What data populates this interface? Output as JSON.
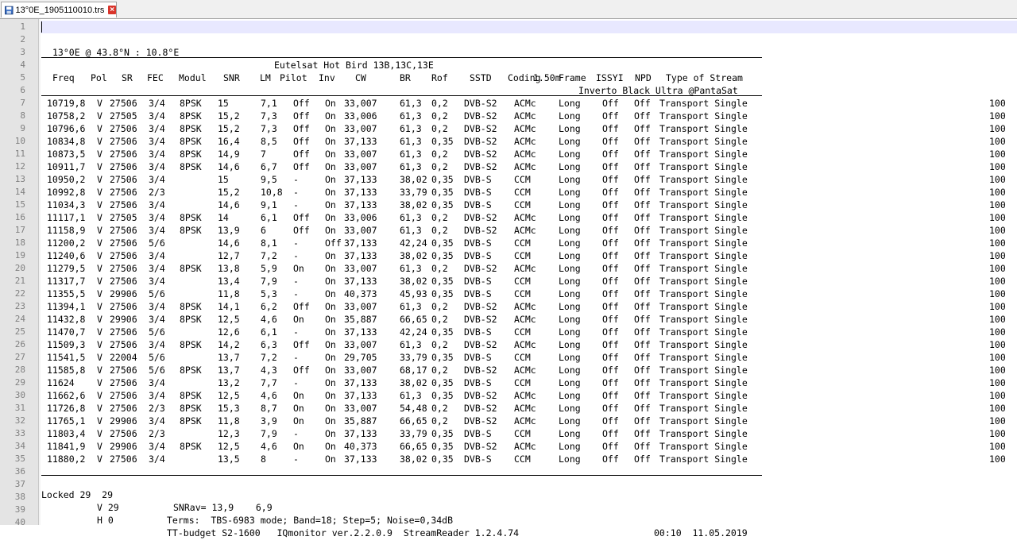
{
  "tab": {
    "label": "13°0E_1905110010.trs",
    "icon": "file-save-icon",
    "close_icon": "close-icon",
    "accent": "#d9342b"
  },
  "header": {
    "position": "13°0E @ 43.8°N : 10.8°E",
    "satellite": "Eutelsat Hot Bird 13B,13C,13E",
    "dish": "1.50m",
    "lnb": "Inverto Black Ultra @PantaSat"
  },
  "columns": [
    "Freq",
    "Pol",
    "SR",
    "FEC",
    "Modul",
    "SNR",
    "LM",
    "Pilot",
    "Inv",
    "CW",
    "BR",
    "Rof",
    "SSTD",
    "Coding",
    "Frame",
    "ISSYI",
    "NPD",
    "Type of Stream"
  ],
  "rows": [
    [
      "10719,8",
      "V",
      "27506",
      "3/4",
      "8PSK",
      "15",
      "7,1",
      "Off",
      "On",
      "33,007",
      "61,3",
      "0,2",
      "DVB-S2",
      "ACMc",
      "Long",
      "Off",
      "Off",
      "Transport Single",
      "100"
    ],
    [
      "10758,2",
      "V",
      "27505",
      "3/4",
      "8PSK",
      "15,2",
      "7,3",
      "Off",
      "On",
      "33,006",
      "61,3",
      "0,2",
      "DVB-S2",
      "ACMc",
      "Long",
      "Off",
      "Off",
      "Transport Single",
      "100"
    ],
    [
      "10796,6",
      "V",
      "27506",
      "3/4",
      "8PSK",
      "15,2",
      "7,3",
      "Off",
      "On",
      "33,007",
      "61,3",
      "0,2",
      "DVB-S2",
      "ACMc",
      "Long",
      "Off",
      "Off",
      "Transport Single",
      "100"
    ],
    [
      "10834,8",
      "V",
      "27506",
      "3/4",
      "8PSK",
      "16,4",
      "8,5",
      "Off",
      "On",
      "37,133",
      "61,3",
      "0,35",
      "DVB-S2",
      "ACMc",
      "Long",
      "Off",
      "Off",
      "Transport Single",
      "100"
    ],
    [
      "10873,5",
      "V",
      "27506",
      "3/4",
      "8PSK",
      "14,9",
      "7",
      "Off",
      "On",
      "33,007",
      "61,3",
      "0,2",
      "DVB-S2",
      "ACMc",
      "Long",
      "Off",
      "Off",
      "Transport Single",
      "100"
    ],
    [
      "10911,7",
      "V",
      "27506",
      "3/4",
      "8PSK",
      "14,6",
      "6,7",
      "Off",
      "On",
      "33,007",
      "61,3",
      "0,2",
      "DVB-S2",
      "ACMc",
      "Long",
      "Off",
      "Off",
      "Transport Single",
      "100"
    ],
    [
      "10950,2",
      "V",
      "27506",
      "3/4",
      "",
      "15",
      "9,5",
      "-",
      "On",
      "37,133",
      "38,02",
      "0,35",
      "DVB-S",
      "CCM",
      "Long",
      "Off",
      "Off",
      "Transport Single",
      "100"
    ],
    [
      "10992,8",
      "V",
      "27506",
      "2/3",
      "",
      "15,2",
      "10,8",
      "-",
      "On",
      "37,133",
      "33,79",
      "0,35",
      "DVB-S",
      "CCM",
      "Long",
      "Off",
      "Off",
      "Transport Single",
      "100"
    ],
    [
      "11034,3",
      "V",
      "27506",
      "3/4",
      "",
      "14,6",
      "9,1",
      "-",
      "On",
      "37,133",
      "38,02",
      "0,35",
      "DVB-S",
      "CCM",
      "Long",
      "Off",
      "Off",
      "Transport Single",
      "100"
    ],
    [
      "11117,1",
      "V",
      "27505",
      "3/4",
      "8PSK",
      "14",
      "6,1",
      "Off",
      "On",
      "33,006",
      "61,3",
      "0,2",
      "DVB-S2",
      "ACMc",
      "Long",
      "Off",
      "Off",
      "Transport Single",
      "100"
    ],
    [
      "11158,9",
      "V",
      "27506",
      "3/4",
      "8PSK",
      "13,9",
      "6",
      "Off",
      "On",
      "33,007",
      "61,3",
      "0,2",
      "DVB-S2",
      "ACMc",
      "Long",
      "Off",
      "Off",
      "Transport Single",
      "100"
    ],
    [
      "11200,2",
      "V",
      "27506",
      "5/6",
      "",
      "14,6",
      "8,1",
      "-",
      "Off",
      "37,133",
      "42,24",
      "0,35",
      "DVB-S",
      "CCM",
      "Long",
      "Off",
      "Off",
      "Transport Single",
      "100"
    ],
    [
      "11240,6",
      "V",
      "27506",
      "3/4",
      "",
      "12,7",
      "7,2",
      "-",
      "On",
      "37,133",
      "38,02",
      "0,35",
      "DVB-S",
      "CCM",
      "Long",
      "Off",
      "Off",
      "Transport Single",
      "100"
    ],
    [
      "11279,5",
      "V",
      "27506",
      "3/4",
      "8PSK",
      "13,8",
      "5,9",
      "On",
      "On",
      "33,007",
      "61,3",
      "0,2",
      "DVB-S2",
      "ACMc",
      "Long",
      "Off",
      "Off",
      "Transport Single",
      "100"
    ],
    [
      "11317,7",
      "V",
      "27506",
      "3/4",
      "",
      "13,4",
      "7,9",
      "-",
      "On",
      "37,133",
      "38,02",
      "0,35",
      "DVB-S",
      "CCM",
      "Long",
      "Off",
      "Off",
      "Transport Single",
      "100"
    ],
    [
      "11355,5",
      "V",
      "29906",
      "5/6",
      "",
      "11,8",
      "5,3",
      "-",
      "On",
      "40,373",
      "45,93",
      "0,35",
      "DVB-S",
      "CCM",
      "Long",
      "Off",
      "Off",
      "Transport Single",
      "100"
    ],
    [
      "11394,1",
      "V",
      "27506",
      "3/4",
      "8PSK",
      "14,1",
      "6,2",
      "Off",
      "On",
      "33,007",
      "61,3",
      "0,2",
      "DVB-S2",
      "ACMc",
      "Long",
      "Off",
      "Off",
      "Transport Single",
      "100"
    ],
    [
      "11432,8",
      "V",
      "29906",
      "3/4",
      "8PSK",
      "12,5",
      "4,6",
      "On",
      "On",
      "35,887",
      "66,65",
      "0,2",
      "DVB-S2",
      "ACMc",
      "Long",
      "Off",
      "Off",
      "Transport Single",
      "100"
    ],
    [
      "11470,7",
      "V",
      "27506",
      "5/6",
      "",
      "12,6",
      "6,1",
      "-",
      "On",
      "37,133",
      "42,24",
      "0,35",
      "DVB-S",
      "CCM",
      "Long",
      "Off",
      "Off",
      "Transport Single",
      "100"
    ],
    [
      "11509,3",
      "V",
      "27506",
      "3/4",
      "8PSK",
      "14,2",
      "6,3",
      "Off",
      "On",
      "33,007",
      "61,3",
      "0,2",
      "DVB-S2",
      "ACMc",
      "Long",
      "Off",
      "Off",
      "Transport Single",
      "100"
    ],
    [
      "11541,5",
      "V",
      "22004",
      "5/6",
      "",
      "13,7",
      "7,2",
      "-",
      "On",
      "29,705",
      "33,79",
      "0,35",
      "DVB-S",
      "CCM",
      "Long",
      "Off",
      "Off",
      "Transport Single",
      "100"
    ],
    [
      "11585,8",
      "V",
      "27506",
      "5/6",
      "8PSK",
      "13,7",
      "4,3",
      "Off",
      "On",
      "33,007",
      "68,17",
      "0,2",
      "DVB-S2",
      "ACMc",
      "Long",
      "Off",
      "Off",
      "Transport Single",
      "100"
    ],
    [
      "11624",
      "V",
      "27506",
      "3/4",
      "",
      "13,2",
      "7,7",
      "-",
      "On",
      "37,133",
      "38,02",
      "0,35",
      "DVB-S",
      "CCM",
      "Long",
      "Off",
      "Off",
      "Transport Single",
      "100"
    ],
    [
      "11662,6",
      "V",
      "27506",
      "3/4",
      "8PSK",
      "12,5",
      "4,6",
      "On",
      "On",
      "37,133",
      "61,3",
      "0,35",
      "DVB-S2",
      "ACMc",
      "Long",
      "Off",
      "Off",
      "Transport Single",
      "100"
    ],
    [
      "11726,8",
      "V",
      "27506",
      "2/3",
      "8PSK",
      "15,3",
      "8,7",
      "On",
      "On",
      "33,007",
      "54,48",
      "0,2",
      "DVB-S2",
      "ACMc",
      "Long",
      "Off",
      "Off",
      "Transport Single",
      "100"
    ],
    [
      "11765,1",
      "V",
      "29906",
      "3/4",
      "8PSK",
      "11,8",
      "3,9",
      "On",
      "On",
      "35,887",
      "66,65",
      "0,2",
      "DVB-S2",
      "ACMc",
      "Long",
      "Off",
      "Off",
      "Transport Single",
      "100"
    ],
    [
      "11803,4",
      "V",
      "27506",
      "2/3",
      "",
      "12,3",
      "7,9",
      "-",
      "On",
      "37,133",
      "33,79",
      "0,35",
      "DVB-S",
      "CCM",
      "Long",
      "Off",
      "Off",
      "Transport Single",
      "100"
    ],
    [
      "11841,9",
      "V",
      "29906",
      "3/4",
      "8PSK",
      "12,5",
      "4,6",
      "On",
      "On",
      "40,373",
      "66,65",
      "0,35",
      "DVB-S2",
      "ACMc",
      "Long",
      "Off",
      "Off",
      "Transport Single",
      "100"
    ],
    [
      "11880,2",
      "V",
      "27506",
      "3/4",
      "",
      "13,5",
      "8",
      "-",
      "On",
      "37,133",
      "38,02",
      "0,35",
      "DVB-S",
      "CCM",
      "Long",
      "Off",
      "Off",
      "Transport Single",
      "100"
    ]
  ],
  "footer": {
    "locked": "Locked 29  29",
    "snrav": "SNRav= 13,9    6,9",
    "v": "V 29",
    "terms": "Terms:  TBS-6983 mode; Band=18; Step=5; Noise=0,34dB",
    "time": "00:10  11.05.2019",
    "h": "H 0",
    "software": "TT-budget S2-1600   IQmonitor ver.2.2.0.9  StreamReader 1.2.4.74"
  },
  "line_numbers": [
    "1",
    "2",
    "3",
    "4",
    "5",
    "6",
    "7",
    "8",
    "9",
    "10",
    "11",
    "12",
    "13",
    "14",
    "15",
    "16",
    "17",
    "18",
    "19",
    "20",
    "21",
    "22",
    "23",
    "24",
    "25",
    "26",
    "27",
    "28",
    "29",
    "30",
    "31",
    "32",
    "33",
    "34",
    "35",
    "36",
    "37",
    "38",
    "39",
    "40"
  ]
}
